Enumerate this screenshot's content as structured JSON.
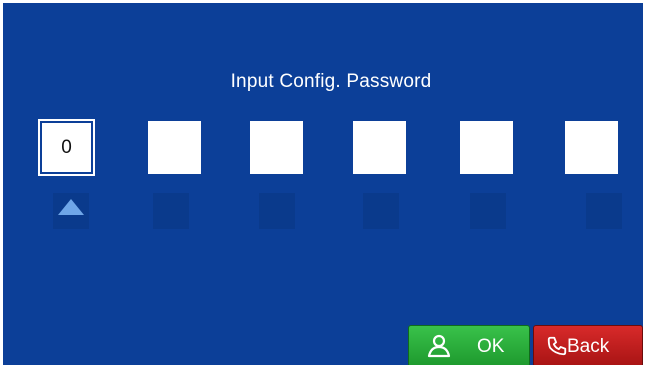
{
  "dialog": {
    "title": "Input Config. Password"
  },
  "password": {
    "digits": [
      "0",
      "",
      "",
      "",
      "",
      ""
    ],
    "active_index": 0
  },
  "buttons": {
    "ok_label": "OK",
    "ok_icon": "user-icon",
    "back_label": "Back",
    "back_icon": "phone-icon"
  },
  "colors": {
    "background": "#0c3f98",
    "ok_button": "#2ab03b",
    "back_button": "#c41e1e",
    "caret": "#6fa6e8"
  }
}
